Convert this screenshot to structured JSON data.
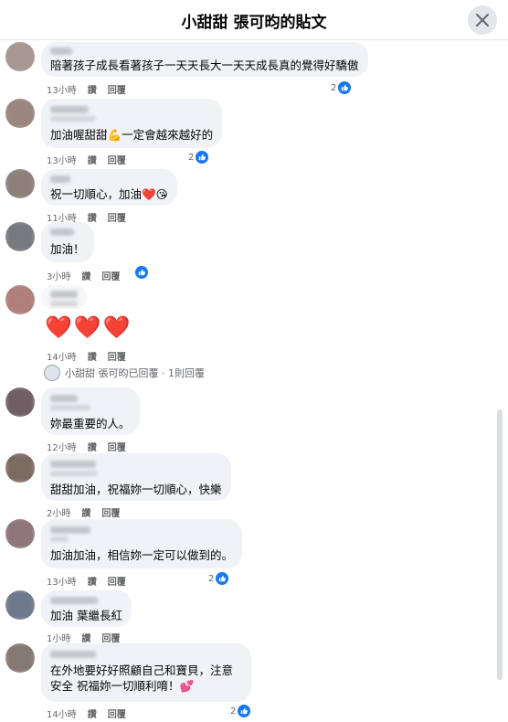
{
  "header": {
    "title": "小甜甜 張可昀的貼文"
  },
  "comments": [
    {
      "text": "陪著孩子成長看著孩子一天天長大一天天成長真的覺得好驕傲",
      "time": "13小時",
      "like": "讚",
      "reply": "回覆",
      "likes": "2"
    },
    {
      "text": "加油喔甜甜💪一定會越來越好的",
      "time": "13小時",
      "like": "讚",
      "reply": "回覆",
      "likes": "2"
    },
    {
      "text": "祝一切順心，加油❤️😘",
      "time": "11小時",
      "like": "讚",
      "reply": "回覆"
    },
    {
      "text": "加油！",
      "time": "3小時",
      "like": "讚",
      "reply": "回覆"
    },
    {
      "text": "❤️❤️❤️",
      "time": "14小時",
      "like": "讚",
      "reply": "回覆",
      "reply_summary": "小甜甜 張可昀已回覆 · 1則回覆"
    },
    {
      "text": "妳最重要的人。",
      "time": "12小時",
      "like": "讚",
      "reply": "回覆"
    },
    {
      "text": "甜甜加油，祝福妳一切順心，快樂",
      "time": "2小時",
      "like": "讚",
      "reply": "回覆"
    },
    {
      "text": "加油加油，相信妳一定可以做到的。",
      "time": "13小時",
      "like": "讚",
      "reply": "回覆",
      "likes": "2"
    },
    {
      "text": "加油 葉繼長紅",
      "time": "1小時",
      "like": "讚",
      "reply": "回覆"
    },
    {
      "text": "在外地要好好照顧自己和寶貝，注意安全 祝福妳一切順利唷！💕",
      "time": "14小時",
      "like": "讚",
      "reply": "回覆",
      "likes": "2"
    }
  ]
}
